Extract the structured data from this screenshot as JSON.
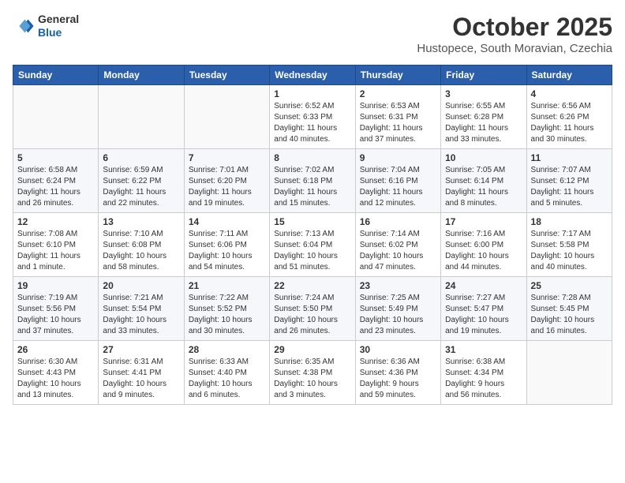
{
  "header": {
    "logo_general": "General",
    "logo_blue": "Blue",
    "month": "October 2025",
    "location": "Hustopece, South Moravian, Czechia"
  },
  "days_of_week": [
    "Sunday",
    "Monday",
    "Tuesday",
    "Wednesday",
    "Thursday",
    "Friday",
    "Saturday"
  ],
  "weeks": [
    [
      {
        "day": "",
        "info": ""
      },
      {
        "day": "",
        "info": ""
      },
      {
        "day": "",
        "info": ""
      },
      {
        "day": "1",
        "info": "Sunrise: 6:52 AM\nSunset: 6:33 PM\nDaylight: 11 hours\nand 40 minutes."
      },
      {
        "day": "2",
        "info": "Sunrise: 6:53 AM\nSunset: 6:31 PM\nDaylight: 11 hours\nand 37 minutes."
      },
      {
        "day": "3",
        "info": "Sunrise: 6:55 AM\nSunset: 6:28 PM\nDaylight: 11 hours\nand 33 minutes."
      },
      {
        "day": "4",
        "info": "Sunrise: 6:56 AM\nSunset: 6:26 PM\nDaylight: 11 hours\nand 30 minutes."
      }
    ],
    [
      {
        "day": "5",
        "info": "Sunrise: 6:58 AM\nSunset: 6:24 PM\nDaylight: 11 hours\nand 26 minutes."
      },
      {
        "day": "6",
        "info": "Sunrise: 6:59 AM\nSunset: 6:22 PM\nDaylight: 11 hours\nand 22 minutes."
      },
      {
        "day": "7",
        "info": "Sunrise: 7:01 AM\nSunset: 6:20 PM\nDaylight: 11 hours\nand 19 minutes."
      },
      {
        "day": "8",
        "info": "Sunrise: 7:02 AM\nSunset: 6:18 PM\nDaylight: 11 hours\nand 15 minutes."
      },
      {
        "day": "9",
        "info": "Sunrise: 7:04 AM\nSunset: 6:16 PM\nDaylight: 11 hours\nand 12 minutes."
      },
      {
        "day": "10",
        "info": "Sunrise: 7:05 AM\nSunset: 6:14 PM\nDaylight: 11 hours\nand 8 minutes."
      },
      {
        "day": "11",
        "info": "Sunrise: 7:07 AM\nSunset: 6:12 PM\nDaylight: 11 hours\nand 5 minutes."
      }
    ],
    [
      {
        "day": "12",
        "info": "Sunrise: 7:08 AM\nSunset: 6:10 PM\nDaylight: 11 hours\nand 1 minute."
      },
      {
        "day": "13",
        "info": "Sunrise: 7:10 AM\nSunset: 6:08 PM\nDaylight: 10 hours\nand 58 minutes."
      },
      {
        "day": "14",
        "info": "Sunrise: 7:11 AM\nSunset: 6:06 PM\nDaylight: 10 hours\nand 54 minutes."
      },
      {
        "day": "15",
        "info": "Sunrise: 7:13 AM\nSunset: 6:04 PM\nDaylight: 10 hours\nand 51 minutes."
      },
      {
        "day": "16",
        "info": "Sunrise: 7:14 AM\nSunset: 6:02 PM\nDaylight: 10 hours\nand 47 minutes."
      },
      {
        "day": "17",
        "info": "Sunrise: 7:16 AM\nSunset: 6:00 PM\nDaylight: 10 hours\nand 44 minutes."
      },
      {
        "day": "18",
        "info": "Sunrise: 7:17 AM\nSunset: 5:58 PM\nDaylight: 10 hours\nand 40 minutes."
      }
    ],
    [
      {
        "day": "19",
        "info": "Sunrise: 7:19 AM\nSunset: 5:56 PM\nDaylight: 10 hours\nand 37 minutes."
      },
      {
        "day": "20",
        "info": "Sunrise: 7:21 AM\nSunset: 5:54 PM\nDaylight: 10 hours\nand 33 minutes."
      },
      {
        "day": "21",
        "info": "Sunrise: 7:22 AM\nSunset: 5:52 PM\nDaylight: 10 hours\nand 30 minutes."
      },
      {
        "day": "22",
        "info": "Sunrise: 7:24 AM\nSunset: 5:50 PM\nDaylight: 10 hours\nand 26 minutes."
      },
      {
        "day": "23",
        "info": "Sunrise: 7:25 AM\nSunset: 5:49 PM\nDaylight: 10 hours\nand 23 minutes."
      },
      {
        "day": "24",
        "info": "Sunrise: 7:27 AM\nSunset: 5:47 PM\nDaylight: 10 hours\nand 19 minutes."
      },
      {
        "day": "25",
        "info": "Sunrise: 7:28 AM\nSunset: 5:45 PM\nDaylight: 10 hours\nand 16 minutes."
      }
    ],
    [
      {
        "day": "26",
        "info": "Sunrise: 6:30 AM\nSunset: 4:43 PM\nDaylight: 10 hours\nand 13 minutes."
      },
      {
        "day": "27",
        "info": "Sunrise: 6:31 AM\nSunset: 4:41 PM\nDaylight: 10 hours\nand 9 minutes."
      },
      {
        "day": "28",
        "info": "Sunrise: 6:33 AM\nSunset: 4:40 PM\nDaylight: 10 hours\nand 6 minutes."
      },
      {
        "day": "29",
        "info": "Sunrise: 6:35 AM\nSunset: 4:38 PM\nDaylight: 10 hours\nand 3 minutes."
      },
      {
        "day": "30",
        "info": "Sunrise: 6:36 AM\nSunset: 4:36 PM\nDaylight: 9 hours\nand 59 minutes."
      },
      {
        "day": "31",
        "info": "Sunrise: 6:38 AM\nSunset: 4:34 PM\nDaylight: 9 hours\nand 56 minutes."
      },
      {
        "day": "",
        "info": ""
      }
    ]
  ]
}
